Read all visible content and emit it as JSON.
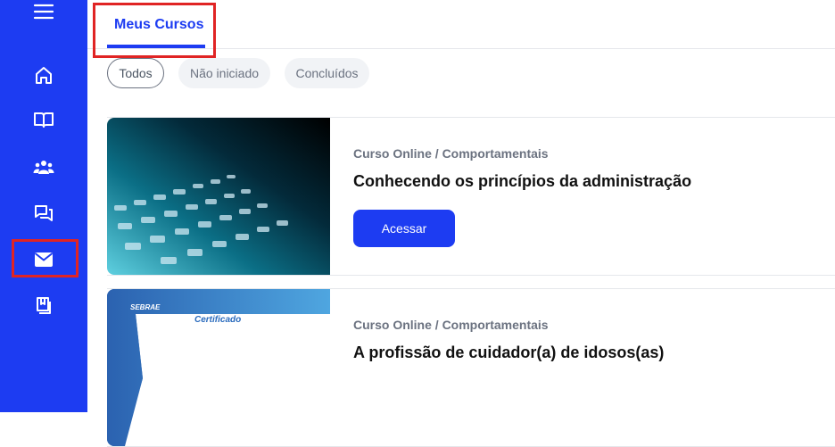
{
  "sidebar": {
    "icons": [
      "menu-icon",
      "home-icon",
      "book-open-icon",
      "users-icon",
      "chat-icon",
      "mail-icon",
      "bookmark-icon"
    ]
  },
  "tabs": [
    {
      "label": "Meus Cursos"
    }
  ],
  "filters": [
    {
      "label": "Todos",
      "active": true
    },
    {
      "label": "Não iniciado",
      "active": false
    },
    {
      "label": "Concluídos",
      "active": false
    }
  ],
  "courses": [
    {
      "category": "Curso Online / Comportamentais",
      "title": "Conhecendo os princípios da administração",
      "button_label": "Acessar",
      "image": "laptop-keyboard-photo"
    },
    {
      "category": "Curso Online / Comportamentais",
      "title": "A profissão de cuidador(a) de idosos(as)",
      "image": "sebrae-certificate",
      "image_texts": {
        "brand": "SEBRAE",
        "caption": "Certificado"
      }
    }
  ],
  "colors": {
    "primary": "#1d3cf2",
    "highlight": "#e02424"
  }
}
